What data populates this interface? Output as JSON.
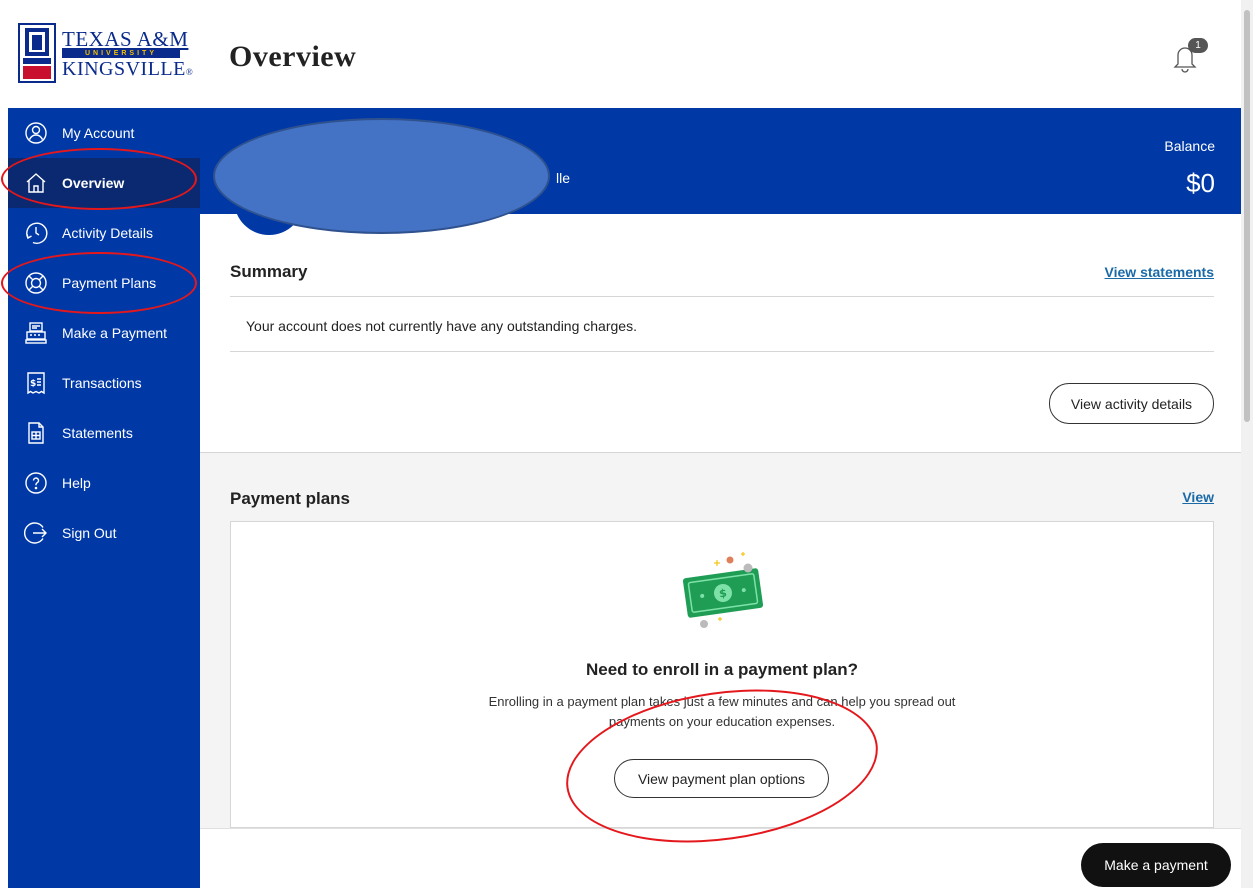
{
  "logo": {
    "line1": "TEXAS A&M",
    "line2": "UNIVERSITY",
    "line3": "KINGSVILLE",
    "mark": "®"
  },
  "header": {
    "title": "Overview",
    "notification_count": "1"
  },
  "sidebar": {
    "items": [
      {
        "label": "My Account",
        "icon": "user-circle-icon"
      },
      {
        "label": "Overview",
        "icon": "home-icon"
      },
      {
        "label": "Activity Details",
        "icon": "clock-icon"
      },
      {
        "label": "Payment Plans",
        "icon": "lifebuoy-icon"
      },
      {
        "label": "Make a Payment",
        "icon": "register-icon"
      },
      {
        "label": "Transactions",
        "icon": "receipt-icon"
      },
      {
        "label": "Statements",
        "icon": "statement-icon"
      },
      {
        "label": "Help",
        "icon": "help-icon"
      },
      {
        "label": "Sign Out",
        "icon": "sign-out-icon"
      }
    ]
  },
  "banner": {
    "school_fragment": "lle",
    "balance_label": "Balance",
    "balance_value": "$0"
  },
  "summary": {
    "title": "Summary",
    "view_statements": "View statements",
    "message": "Your account does not currently have any outstanding charges.",
    "view_activity": "View activity details"
  },
  "payment_plans": {
    "title": "Payment plans",
    "view": "View",
    "heading": "Need to enroll in a payment plan?",
    "body": "Enrolling in a payment plan takes just a few minutes and can help you spread out payments on your education expenses.",
    "options_button": "View payment plan options"
  },
  "footer": {
    "make_payment": "Make a payment"
  },
  "colors": {
    "brand_blue": "#0039a6",
    "active_nav": "#0a2970",
    "annotation_red": "#e4181c",
    "link": "#1a6aa8"
  }
}
